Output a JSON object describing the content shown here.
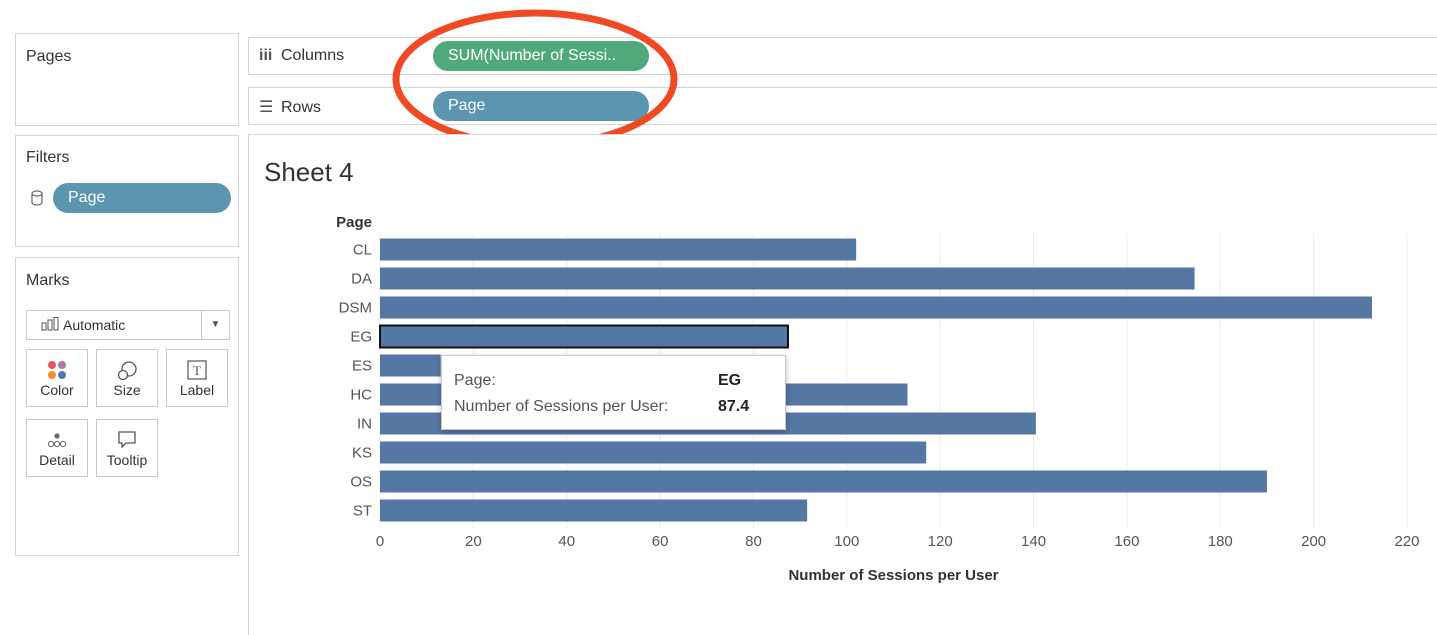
{
  "left_pane": {
    "pages_title": "Pages",
    "filters_title": "Filters",
    "filter_pill": "Page",
    "marks_title": "Marks",
    "mark_type": "Automatic",
    "mark_buttons": [
      {
        "label": "Color",
        "icon": "color-dots-icon"
      },
      {
        "label": "Size",
        "icon": "size-icon"
      },
      {
        "label": "Label",
        "icon": "text-label-icon"
      },
      {
        "label": "Detail",
        "icon": "detail-dots-icon"
      },
      {
        "label": "Tooltip",
        "icon": "speech-bubble-icon"
      }
    ]
  },
  "shelves": {
    "columns_label": "Columns",
    "columns_pill": "SUM(Number of Sessi..",
    "rows_label": "Rows",
    "rows_pill": "Page"
  },
  "sheet": {
    "title": "Sheet 4"
  },
  "tooltip": {
    "page_label": "Page:",
    "page_value": "EG",
    "metric_label": "Number of Sessions per User:",
    "metric_value": "87.4"
  },
  "colors": {
    "bar": "#5577a3",
    "highlight_outline": "#111111",
    "annotation": "#f04a24",
    "pill_green": "#4fa97b",
    "pill_blue": "#5b95b0"
  },
  "chart_data": {
    "type": "bar",
    "orientation": "horizontal",
    "title": "Sheet 4",
    "category_axis_title": "Page",
    "xlabel": "Number of Sessions per User",
    "categories": [
      "CL",
      "DA",
      "DSM",
      "EG",
      "ES",
      "HC",
      "IN",
      "KS",
      "OS",
      "ST"
    ],
    "values": [
      102,
      174.5,
      212.5,
      87.4,
      13,
      113,
      140.5,
      117,
      190,
      91.5
    ],
    "xlim": [
      0,
      220
    ],
    "xticks": [
      0,
      20,
      40,
      60,
      80,
      100,
      120,
      140,
      160,
      180,
      200,
      220
    ],
    "highlighted_category": "EG",
    "grid": "vertical"
  }
}
